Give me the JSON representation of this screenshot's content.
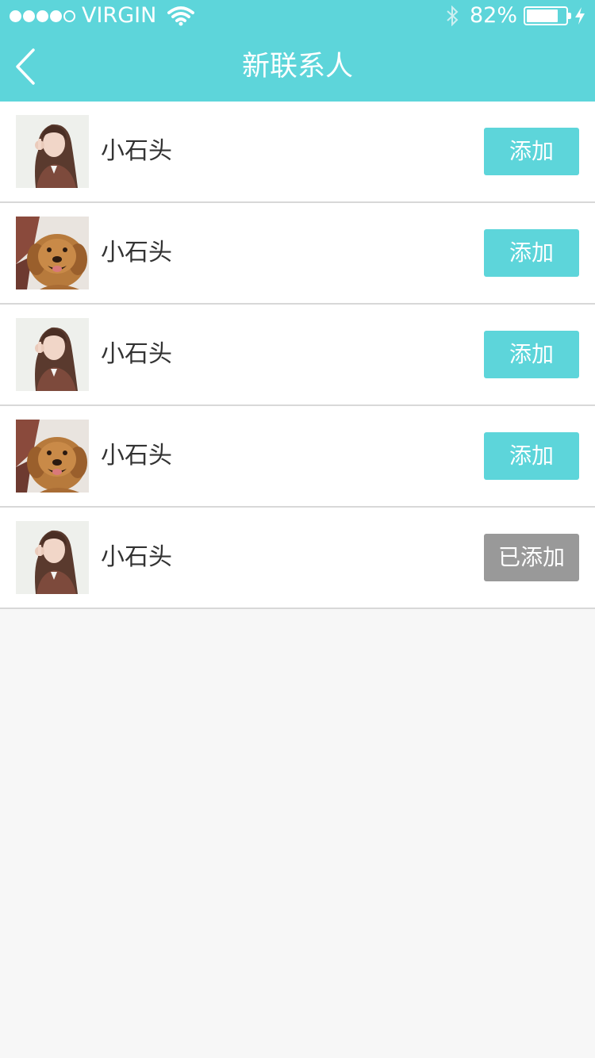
{
  "status_bar": {
    "carrier": "VIRGIN",
    "battery_text": "82%",
    "battery_level": 0.82,
    "signal_bars": 4,
    "signal_total": 5
  },
  "nav": {
    "title": "新联系人",
    "back_icon": "chevron-left-icon"
  },
  "colors": {
    "accent": "#5dd5da",
    "added_button": "#999999",
    "background": "#f7f7f7"
  },
  "contacts": [
    {
      "name": "小石头",
      "avatar": "woman-photo",
      "button": "添加",
      "added": false
    },
    {
      "name": "小石头",
      "avatar": "dog-photo",
      "button": "添加",
      "added": false
    },
    {
      "name": "小石头",
      "avatar": "woman-photo",
      "button": "添加",
      "added": false
    },
    {
      "name": "小石头",
      "avatar": "dog-photo",
      "button": "添加",
      "added": false
    },
    {
      "name": "小石头",
      "avatar": "woman-photo",
      "button": "已添加",
      "added": true
    }
  ]
}
